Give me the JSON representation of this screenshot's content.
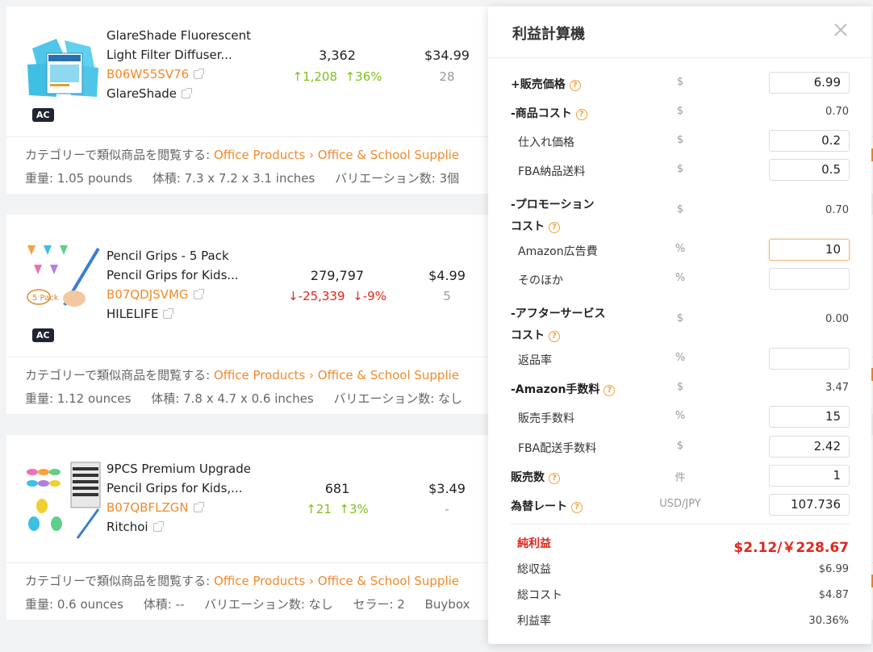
{
  "products": [
    {
      "title_line1": "GlareShade Fluorescent",
      "title_line2": "Light Filter Diffuser...",
      "asin": "B06W55SV76",
      "brand": "GlareShade",
      "badge": "AC",
      "rank": "3,362",
      "rank_change": "1,208",
      "rank_change_pct": "36%",
      "rank_direction": "up",
      "price": "$34.99",
      "price_sub": "28",
      "category_prefix": "カテゴリーで類似商品を閲覧する: ",
      "category_link": "Office Products › Office & School Supplie",
      "weight": "重量: 1.05 pounds",
      "volume": "体積: 7.3 x 7.2 x 3.1 inches",
      "variations": "バリエーション数: 3個",
      "sellers": "",
      "buybox": ""
    },
    {
      "title_line1": "Pencil Grips - 5 Pack",
      "title_line2": "Pencil Grips for Kids...",
      "asin": "B07QDJSVMG",
      "brand": "HILELIFE",
      "badge": "AC",
      "rank": "279,797",
      "rank_change": "-25,339",
      "rank_change_pct": "-9%",
      "rank_direction": "down",
      "price": "$4.99",
      "price_sub": "5",
      "category_prefix": "カテゴリーで類似商品を閲覧する: ",
      "category_link": "Office Products › Office & School Supplie",
      "weight": "重量: 1.12 ounces",
      "volume": "体積: 7.8 x 4.7 x 0.6 inches",
      "variations": "バリエーション数: なし",
      "sellers": "",
      "buybox": ""
    },
    {
      "title_line1": "9PCS Premium Upgrade",
      "title_line2": "Pencil Grips for Kids,...",
      "asin": "B07QBFLZGN",
      "brand": "Ritchoi",
      "badge": "",
      "rank": "681",
      "rank_change": "21",
      "rank_change_pct": "3%",
      "rank_direction": "up",
      "price": "$3.49",
      "price_sub": "-",
      "category_prefix": "カテゴリーで類似商品を閲覧する: ",
      "category_link": "Office Products › Office & School Supplie",
      "weight": "重量: 0.6 ounces",
      "volume": "体積: --",
      "variations": "バリエーション数: なし",
      "sellers": "セラー: 2",
      "buybox": "Buybox"
    }
  ],
  "calculator": {
    "title": "利益計算機",
    "rows": [
      {
        "label": "+販売価格",
        "help": true,
        "bold": true,
        "unit": "$",
        "input": "6.99"
      },
      {
        "label": "-商品コスト",
        "help": true,
        "bold": true,
        "unit": "$",
        "value": "0.70"
      },
      {
        "label": "仕入れ価格",
        "sub": true,
        "unit": "$",
        "input": "0.2"
      },
      {
        "label": "FBA納品送料",
        "sub": true,
        "unit": "$",
        "input": "0.5"
      },
      {
        "label": "-プロモーション",
        "label2": "コスト",
        "help": true,
        "bold": true,
        "unit": "$",
        "value": "0.70"
      },
      {
        "label": "Amazon広告費",
        "sub": true,
        "unit": "%",
        "input": "10",
        "active": true
      },
      {
        "label": "そのほか",
        "sub": true,
        "unit": "%",
        "input": ""
      },
      {
        "label": "-アフターサービス",
        "label2": "コスト",
        "help": true,
        "bold": true,
        "unit": "$",
        "value": "0.00"
      },
      {
        "label": "返品率",
        "sub": true,
        "unit": "%",
        "input": ""
      },
      {
        "label": "-Amazon手数料",
        "help": true,
        "bold": true,
        "unit": "$",
        "value": "3.47"
      },
      {
        "label": "販売手数料",
        "sub": true,
        "unit": "%",
        "input": "15"
      },
      {
        "label": "FBA配送手数料",
        "sub": true,
        "unit": "$",
        "input": "2.42"
      },
      {
        "label": "販売数",
        "help": true,
        "bold": true,
        "unit": "件",
        "input": "1"
      },
      {
        "label": "為替レート",
        "help": true,
        "bold": true,
        "unit": "USD/JPY",
        "input": "107.736"
      }
    ],
    "net_profit_label": "純利益",
    "net_profit_value": "$2.12/￥228.67",
    "summary": [
      {
        "label": "総収益",
        "value": "$6.99"
      },
      {
        "label": "総コスト",
        "value": "$4.87"
      },
      {
        "label": "利益率",
        "value": "30.36%"
      }
    ]
  }
}
